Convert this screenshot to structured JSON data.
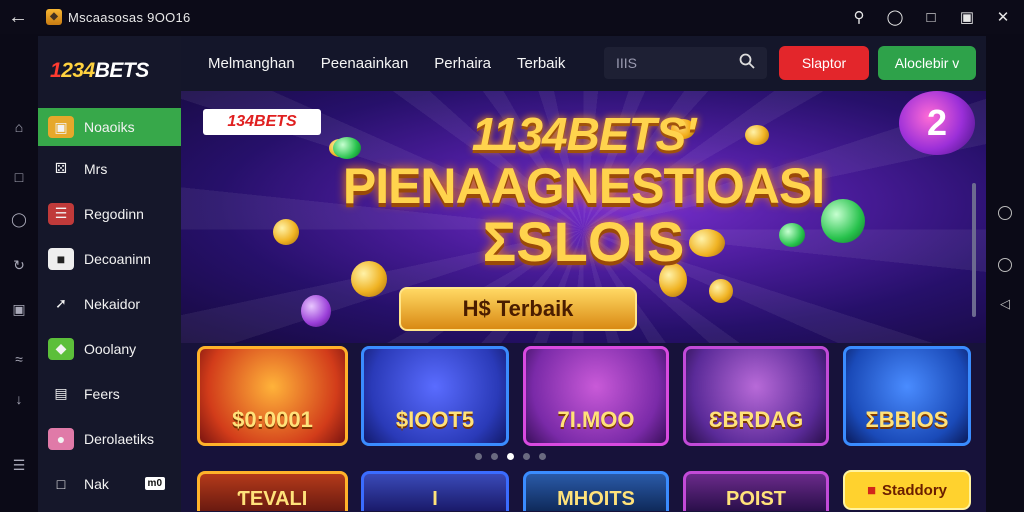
{
  "statusbar": {
    "back_icon": "back-arrow-icon",
    "app_title": "Mscaasosas 9OO16",
    "icons": [
      "search-icon",
      "chat-icon",
      "screenshot-icon",
      "lock-icon",
      "close-icon"
    ]
  },
  "sidebar": {
    "logo": {
      "part1": "1",
      "part2": "234",
      "part3": "BETS"
    },
    "items": [
      {
        "label": "Noaoiks",
        "icon": "chest-icon",
        "active": true
      },
      {
        "label": "Mrs",
        "icon": "dice-icon"
      },
      {
        "label": "Regodinn",
        "icon": "slot-icon"
      },
      {
        "label": "Decoaninn",
        "icon": "card-icon"
      },
      {
        "label": "Nekaidor",
        "icon": "arrow-icon"
      },
      {
        "label": "Ooolany",
        "icon": "gem-icon"
      },
      {
        "label": "Feers",
        "icon": "document-icon"
      },
      {
        "label": "Derolaetiks",
        "icon": "pig-icon"
      },
      {
        "label": "Nak",
        "icon": "box-icon",
        "badge": "m0"
      }
    ]
  },
  "header": {
    "menu": [
      "Melmanghan",
      "Peenaainkan",
      "Perhaira",
      "Terbaik"
    ],
    "search_placeholder": "IIIS",
    "login_label": "Slaptor",
    "register_label": "Aloclebir v"
  },
  "hero": {
    "brand_chip": "134BETS",
    "title1": "1134BETS'",
    "title2": "PIENAAGNESTIOASI",
    "title3": "ƩSLOIS",
    "ribbon": "H$ Terbaik",
    "orb_text": "2"
  },
  "tiles": [
    {
      "label": "$0:0001"
    },
    {
      "label": "$IOOT5"
    },
    {
      "label": "7I.MOO"
    },
    {
      "label": "ƐBRDAG"
    },
    {
      "label": "ƩBBIOS"
    }
  ],
  "tiles_row2": [
    {
      "label": "ƬEVALI"
    },
    {
      "label": "I"
    },
    {
      "label": "MHOITS"
    },
    {
      "label": "POIST"
    }
  ],
  "cta_label": "Staddory",
  "carousel": {
    "count": 5,
    "active": 3
  },
  "colors": {
    "sidebar_active": "#37a84a",
    "login_button": "#e3262b",
    "register_button": "#2ea24a",
    "gold_text": "#ffd34d",
    "cta": "#ffd22e"
  }
}
